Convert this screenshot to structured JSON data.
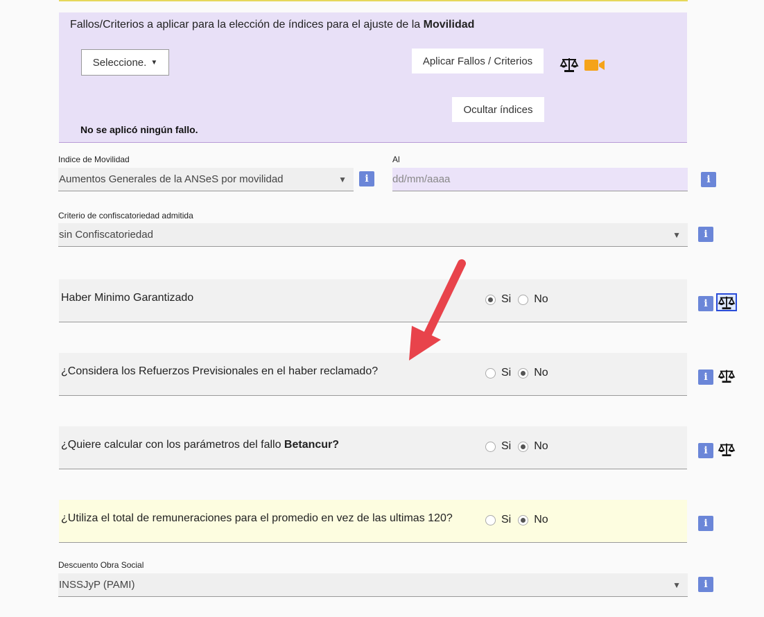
{
  "fallos": {
    "title_prefix": "Fallos/Criterios a aplicar para la elección de índices para el ajuste de la ",
    "title_bold": "Movilidad",
    "select_label": "Seleccione.",
    "aplicar_label": "Aplicar Fallos / Criterios",
    "ocultar_label": "Ocultar índices",
    "status_text": "No se aplicó ningún fallo."
  },
  "movilidad": {
    "label": "Indice de Movilidad",
    "value": "Aumentos Generales de la ANSeS por movilidad",
    "al_label": "Al",
    "al_placeholder": "dd/mm/aaaa"
  },
  "confiscatoriedad": {
    "label": "Criterio de confiscatoriedad admitida",
    "value": "sin Confiscatoriedad"
  },
  "questions": [
    {
      "text": "Haber Minimo Garantizado",
      "bold": "",
      "selected": "Si"
    },
    {
      "text": "¿Considera los Refuerzos Previsionales en el haber reclamado?",
      "bold": "",
      "selected": "No"
    },
    {
      "text": "¿Quiere calcular con los parámetros del fallo ",
      "bold": "Betancur?",
      "selected": "No"
    },
    {
      "text": "¿Utiliza el total de remuneraciones para el promedio en vez de las ultimas 120?",
      "bold": "",
      "selected": "No"
    }
  ],
  "radio_labels": {
    "si": "Si",
    "no": "No"
  },
  "obra_social": {
    "label": "Descuento Obra Social",
    "value": "INSSJyP (PAMI)"
  },
  "icons": {
    "info": "i",
    "arrow_down": "▼",
    "caret": "▼"
  },
  "colors": {
    "lavender_box": "#e8e0f7",
    "info_blue": "#6b86d8",
    "camera_orange": "#f5a31a",
    "annotation_red": "#e8434b",
    "yellow_row": "#fdfde0"
  }
}
